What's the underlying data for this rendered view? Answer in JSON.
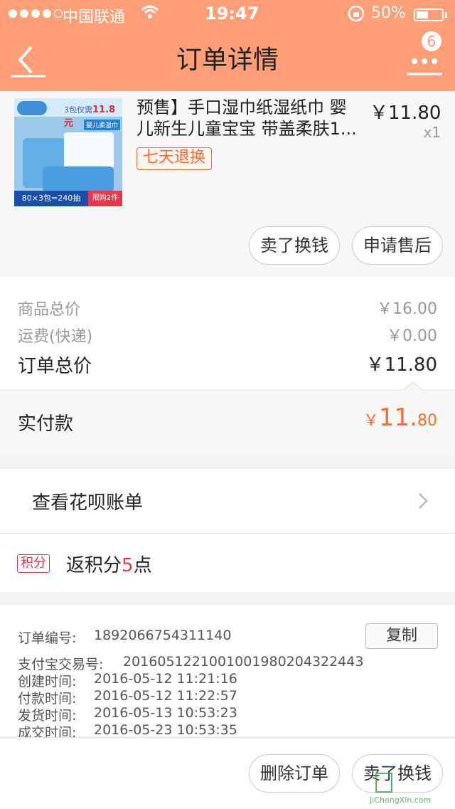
{
  "status_bar": {
    "carrier": "中国联通",
    "time": "19:47",
    "battery": "50%"
  },
  "nav": {
    "title": "订单详情",
    "badge_count": "6",
    "back_icon": "back-chevron-icon",
    "more_icon": "more-dots-icon"
  },
  "product": {
    "title": "预售】手口湿巾纸湿纸巾 婴儿新生儿童宝宝 带盖柔肤1...",
    "price": "￥11.80",
    "quantity": "x1",
    "return_tag": "七天退换",
    "thumb_text": {
      "promo": "3包仅需",
      "promo_price": "11.8元",
      "chip": "婴儿柔湿巾",
      "count": "80×3包=240抽",
      "limit": "限购2件"
    },
    "actions": [
      "卖了换钱",
      "申请售后"
    ]
  },
  "summary": {
    "goods_total_label": "商品总价",
    "goods_total": "￥16.00",
    "shipping_label": "运费(快递)",
    "shipping": "￥0.00",
    "order_total_label": "订单总价",
    "order_total": "￥11.80",
    "paid_label": "实付款",
    "paid_currency": "￥",
    "paid_int": "11.",
    "paid_dec": "80"
  },
  "huabei": {
    "label": "查看花呗账单"
  },
  "points": {
    "tag": "积分",
    "text_prefix": "返积分",
    "value": "5",
    "text_suffix": "点"
  },
  "order_info": {
    "copy_label": "复制",
    "rows": [
      {
        "label": "订单编号:",
        "value": "1892066754311140"
      },
      {
        "label": "支付宝交易号:",
        "value": "2016051221001001980204322443"
      },
      {
        "label": "创建时间:",
        "value": "2016-05-12 11:21:16"
      },
      {
        "label": "付款时间:",
        "value": "2016-05-12 11:22:57"
      },
      {
        "label": "发货时间:",
        "value": "2016-05-13 10:53:23"
      },
      {
        "label": "成交时间:",
        "value": "2016-05-23 10:53:35"
      }
    ]
  },
  "footer": {
    "actions": [
      "删除订单",
      "卖了换钱"
    ],
    "watermark": "JiChengXin.com"
  },
  "colors": {
    "header": "#ff9f78",
    "accent": "#ff6a2f",
    "points": "#e8364f"
  }
}
